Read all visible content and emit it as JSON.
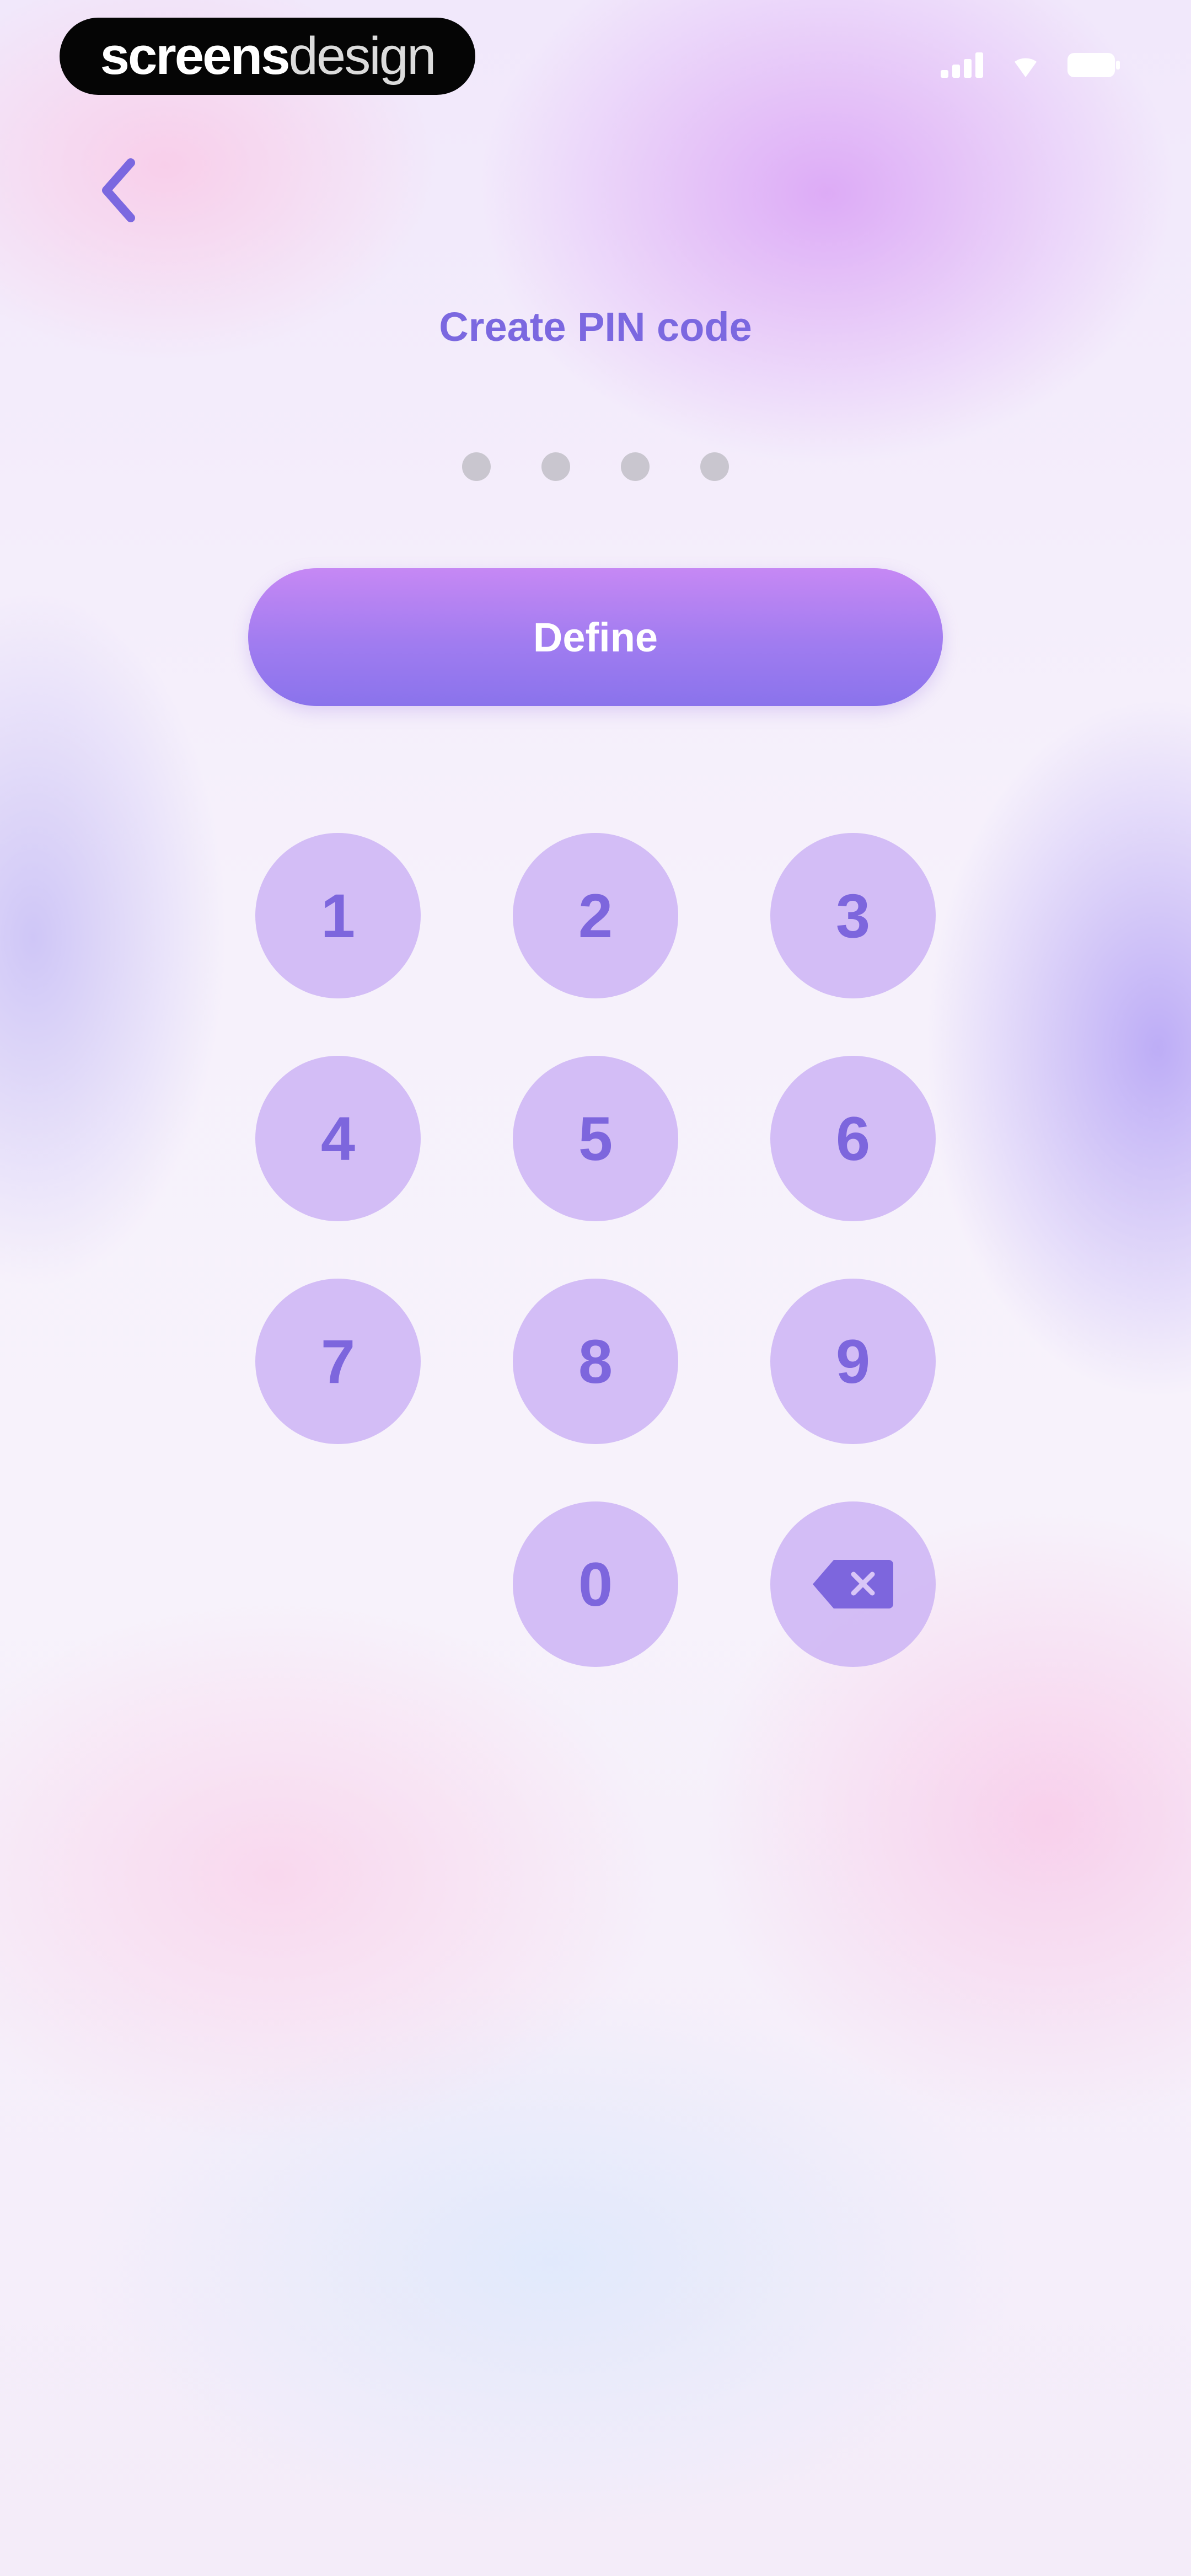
{
  "status_bar": {
    "brand_part1": "screens",
    "brand_part2": "design",
    "icons": [
      "signal-icon",
      "wifi-icon",
      "battery-icon"
    ]
  },
  "header": {
    "back_icon": "chevron-left-icon"
  },
  "title": "Create PIN code",
  "pin": {
    "length": 4,
    "entered": 0
  },
  "define_button": {
    "label": "Define"
  },
  "keypad": {
    "keys": [
      "1",
      "2",
      "3",
      "4",
      "5",
      "6",
      "7",
      "8",
      "9",
      "",
      "0",
      "backspace"
    ],
    "backspace_icon": "backspace-icon"
  },
  "colors": {
    "accent": "#7b68e0",
    "button_gradient_top": "#c688f4",
    "button_gradient_bottom": "#8a73ec",
    "key_background": "#cdb4f5",
    "pin_dot": "#c9c6cf"
  }
}
